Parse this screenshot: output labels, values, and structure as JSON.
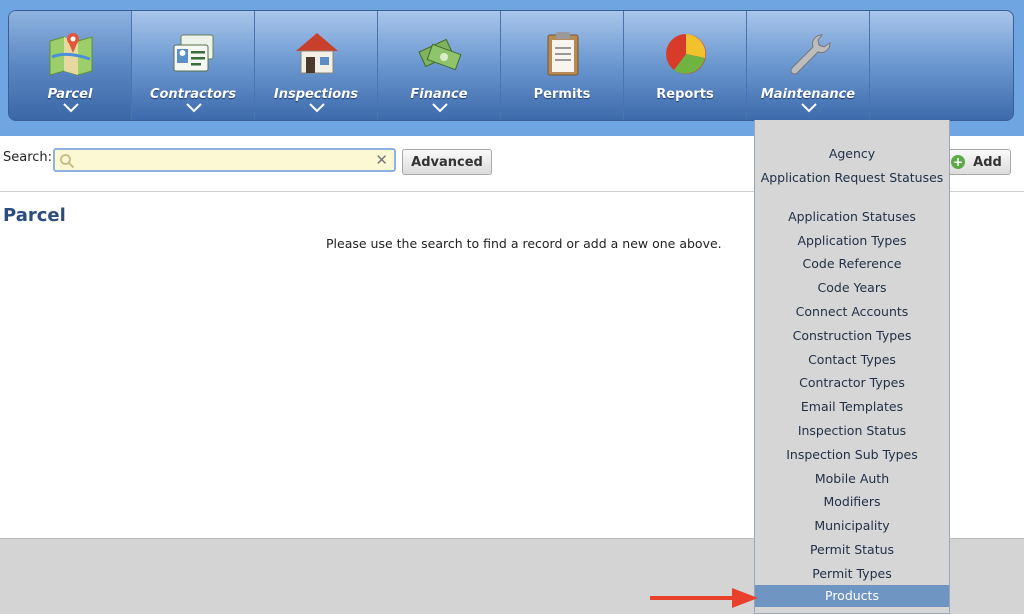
{
  "nav": {
    "items": [
      {
        "label": "Parcel",
        "icon": "map-icon"
      },
      {
        "label": "Contractors",
        "icon": "id-card-icon"
      },
      {
        "label": "Inspections",
        "icon": "house-icon"
      },
      {
        "label": "Finance",
        "icon": "money-icon"
      },
      {
        "label": "Permits",
        "icon": "clipboard-icon"
      },
      {
        "label": "Reports",
        "icon": "pie-chart-icon"
      },
      {
        "label": "Maintenance",
        "icon": "wrench-icon"
      }
    ]
  },
  "search": {
    "label": "Search:",
    "value": "",
    "placeholder": ""
  },
  "toolbar": {
    "advanced_label": "Advanced",
    "add_label": "Add"
  },
  "page": {
    "title": "Parcel",
    "empty_message": "Please use the search to find a record or add a new one above."
  },
  "maintenance_menu": {
    "items": [
      "Agency",
      "Application Request Statuses",
      "Application Statuses",
      "Application Types",
      "Code Reference",
      "Code Years",
      "Connect Accounts",
      "Construction Types",
      "Contact Types",
      "Contractor Types",
      "Email Templates",
      "Inspection Status",
      "Inspection Sub Types",
      "Mobile Auth",
      "Modifiers",
      "Municipality",
      "Permit Status",
      "Permit Types",
      "Products"
    ],
    "highlighted": "Products"
  },
  "colors": {
    "nav_dark": "#3d6aab",
    "highlight": "#6f95c3",
    "arrow": "#e8402a",
    "title": "#2b4c7e"
  }
}
